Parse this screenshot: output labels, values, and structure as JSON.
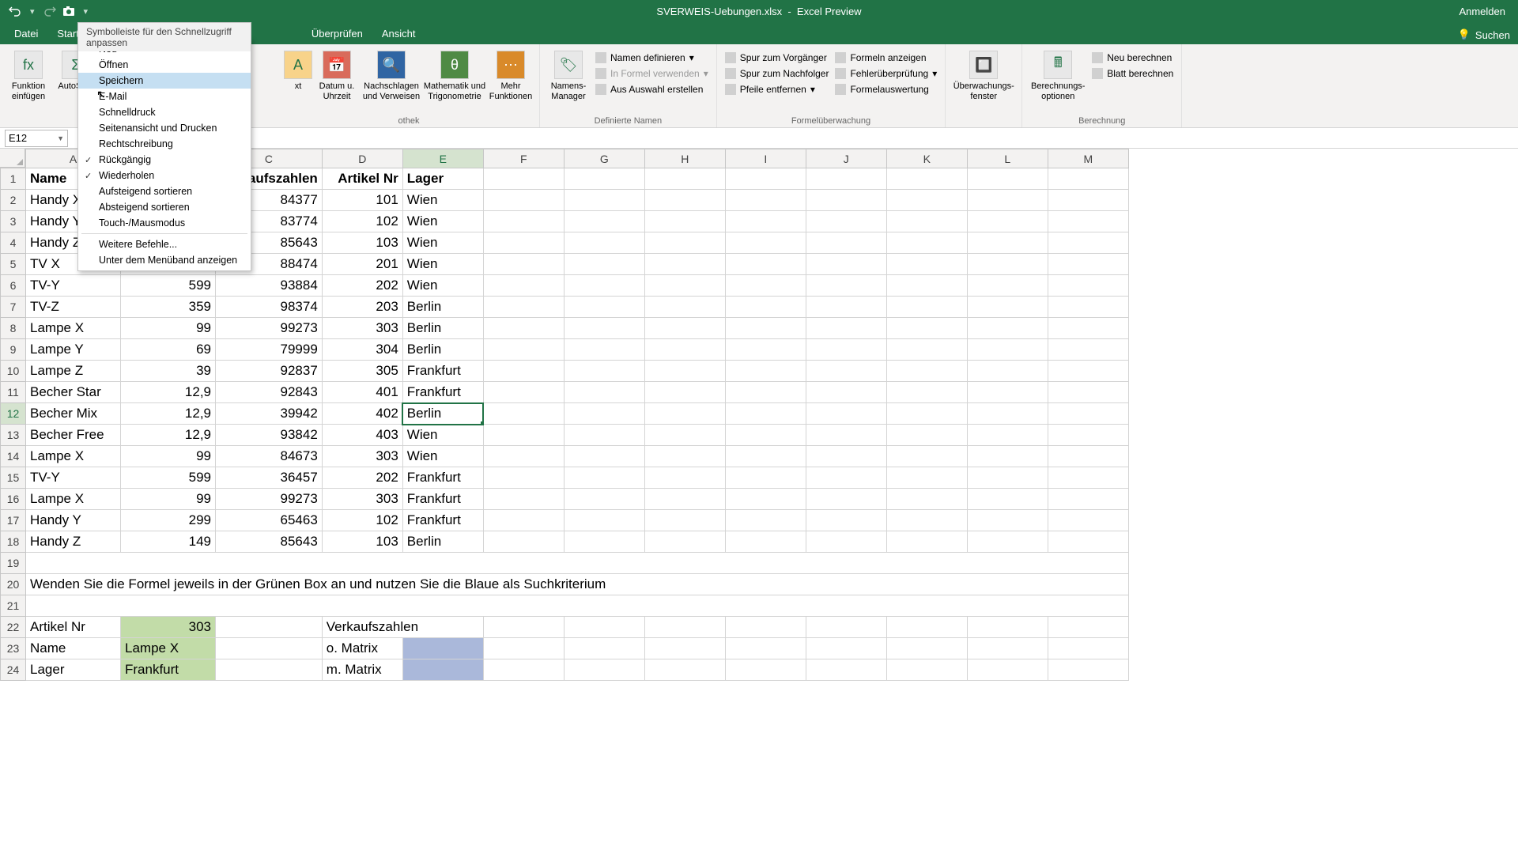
{
  "title": {
    "filename": "SVERWEIS-Uebungen.xlsx",
    "app": "Excel Preview",
    "signin": "Anmelden"
  },
  "tabs": {
    "datei": "Datei",
    "start": "Start",
    "ueberpruefen": "Überprüfen",
    "ansicht": "Ansicht",
    "suchen": "Suchen"
  },
  "qat_header": "Symbolleiste für den Schnellzugriff anpassen",
  "qat_menu": {
    "neu": "Neu",
    "oeffnen": "Öffnen",
    "speichern": "Speichern",
    "email": "E-Mail",
    "schnelldruck": "Schnelldruck",
    "seitenansicht": "Seitenansicht und Drucken",
    "rechtschreibung": "Rechtschreibung",
    "rueckgaengig": "Rückgängig",
    "wiederholen": "Wiederholen",
    "aufsteigend": "Aufsteigend sortieren",
    "absteigend": "Absteigend sortieren",
    "touch": "Touch-/Mausmodus",
    "weiter": "Weitere Befehle...",
    "unter": "Unter dem Menüband anzeigen"
  },
  "ribbon": {
    "funktion": "Funktion\neinfügen",
    "autosum": "AutoSum",
    "xt": "xt",
    "datum": "Datum u.\nUhrzeit",
    "nachschlagen": "Nachschlagen\nund Verweisen",
    "mathe": "Mathematik und\nTrigonometrie",
    "mehr": "Mehr\nFunktionen",
    "othek": "othek",
    "namensmgr": "Namens-\nManager",
    "namendef": "Namen definieren",
    "informel": "In Formel verwenden",
    "ausauswahl": "Aus Auswahl erstellen",
    "defnamen": "Definierte Namen",
    "spurv": "Spur zum Vorgänger",
    "spurn": "Spur zum Nachfolger",
    "pfeile": "Pfeile entfernen",
    "formelnanz": "Formeln anzeigen",
    "fehler": "Fehlerüberprüfung",
    "formelaus": "Formelauswertung",
    "formelueber": "Formelüberwachung",
    "uefenster": "Überwachungs-\nfenster",
    "berechopt": "Berechnungs-\noptionen",
    "neuberech": "Neu berechnen",
    "blattberech": "Blatt berechnen",
    "berechnung": "Berechnung"
  },
  "namebox": "E12",
  "cols": {
    "A": "A",
    "B": "B",
    "C": "C",
    "D": "D",
    "E": "E",
    "F": "F",
    "G": "G",
    "H": "H",
    "I": "I",
    "J": "J",
    "K": "K",
    "L": "L",
    "M": "M"
  },
  "headers": {
    "name": "Name",
    "verkaufszahlen": "Verkaufszahlen",
    "artikelnr": "Artikel Nr",
    "lager": "Lager"
  },
  "rows": [
    {
      "n": "Handy X",
      "c": "84377",
      "d": "101",
      "e": "Wien"
    },
    {
      "n": "Handy Y",
      "c": "83774",
      "d": "102",
      "e": "Wien"
    },
    {
      "n": "Handy Z",
      "c": "85643",
      "d": "103",
      "e": "Wien"
    },
    {
      "n": "TV X",
      "b": "",
      "c": "88474",
      "d": "201",
      "e": "Wien"
    },
    {
      "n": "TV-Y",
      "b": "599",
      "c": "93884",
      "d": "202",
      "e": "Wien"
    },
    {
      "n": "TV-Z",
      "b": "359",
      "c": "98374",
      "d": "203",
      "e": "Berlin"
    },
    {
      "n": "Lampe X",
      "b": "99",
      "c": "99273",
      "d": "303",
      "e": "Berlin"
    },
    {
      "n": "Lampe Y",
      "b": "69",
      "c": "79999",
      "d": "304",
      "e": "Berlin"
    },
    {
      "n": "Lampe Z",
      "b": "39",
      "c": "92837",
      "d": "305",
      "e": "Frankfurt"
    },
    {
      "n": "Becher Star",
      "b": "12,9",
      "c": "92843",
      "d": "401",
      "e": "Frankfurt"
    },
    {
      "n": "Becher Mix",
      "b": "12,9",
      "c": "39942",
      "d": "402",
      "e": "Berlin"
    },
    {
      "n": "Becher Free",
      "b": "12,9",
      "c": "93842",
      "d": "403",
      "e": "Wien"
    },
    {
      "n": "Lampe X",
      "b": "99",
      "c": "84673",
      "d": "303",
      "e": "Wien"
    },
    {
      "n": "TV-Y",
      "b": "599",
      "c": "36457",
      "d": "202",
      "e": "Frankfurt"
    },
    {
      "n": "Lampe X",
      "b": "99",
      "c": "99273",
      "d": "303",
      "e": "Frankfurt"
    },
    {
      "n": "Handy Y",
      "b": "299",
      "c": "65463",
      "d": "102",
      "e": "Frankfurt"
    },
    {
      "n": "Handy Z",
      "b": "149",
      "c": "85643",
      "d": "103",
      "e": "Berlin"
    }
  ],
  "instruction": "Wenden Sie die Formel jeweils in der Grünen Box an und nutzen Sie die Blaue als Suchkriterium",
  "lookup": {
    "artikelnr_lbl": "Artikel Nr",
    "artikelnr_val": "303",
    "name_lbl": "Name",
    "name_val": "Lampe X",
    "lager_lbl": "Lager",
    "lager_val": "Frankfurt",
    "verkaufszahlen_lbl": "Verkaufszahlen",
    "omatrix": "o. Matrix",
    "mmatrix": "m. Matrix"
  }
}
